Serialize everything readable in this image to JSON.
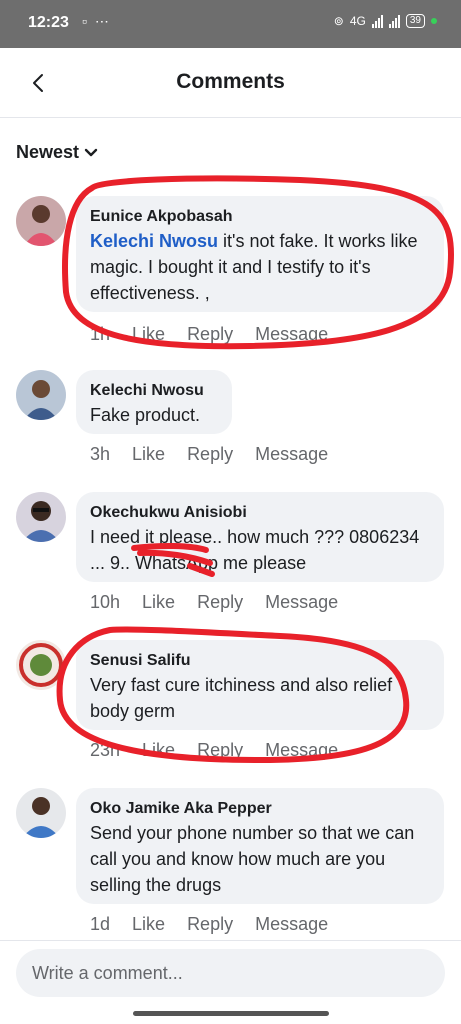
{
  "status": {
    "time": "12:23",
    "left_icons": "▫ ⋯",
    "network": "4G",
    "battery": "39",
    "accent": "#37d159"
  },
  "header": {
    "title": "Comments"
  },
  "sort": {
    "label": "Newest"
  },
  "comments": [
    {
      "author": "Eunice Akpobasah",
      "mention": "Kelechi Nwosu",
      "text": " it's not fake. It works like magic. I bought it and I testify to it's effectiveness. ,",
      "time": "1h",
      "like": "Like",
      "reply": "Reply",
      "message": "Message"
    },
    {
      "author": "Kelechi Nwosu",
      "text": "Fake product.",
      "time": "3h",
      "like": "Like",
      "reply": "Reply",
      "message": "Message"
    },
    {
      "author": "Okechukwu Anisiobi",
      "text": "I need it please.. how much ??? 0806234 ... 9.. WhatsApp me please",
      "time": "10h",
      "like": "Like",
      "reply": "Reply",
      "message": "Message"
    },
    {
      "author": "Senusi Salifu",
      "text": "Very fast cure itchiness and also relief body germ",
      "time": "23h",
      "like": "Like",
      "reply": "Reply",
      "message": "Message"
    },
    {
      "author": "Oko Jamike Aka Pepper",
      "text": "Send your phone number so that we can call you and know how much are you selling the drugs",
      "time": "1d",
      "like": "Like",
      "reply": "Reply",
      "message": "Message"
    }
  ],
  "composer": {
    "placeholder": "Write a comment..."
  },
  "colors": {
    "mention": "#1f5ec7",
    "annotation": "#e8212a",
    "bubble": "#f0f2f5"
  }
}
